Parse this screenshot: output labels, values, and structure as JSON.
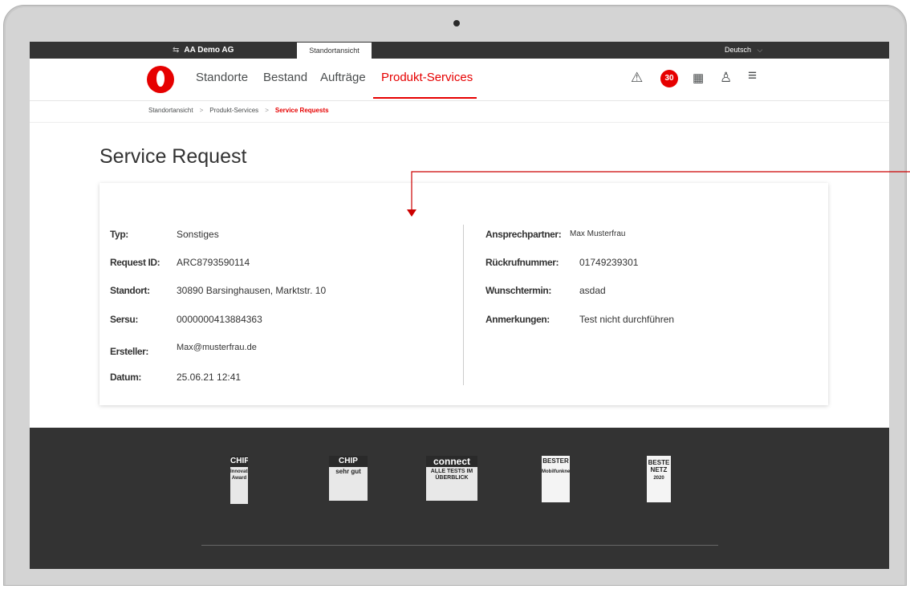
{
  "topbar": {
    "company": "AA Demo AG",
    "view_tab": "Standortansicht",
    "language": "Deutsch"
  },
  "nav": {
    "items": [
      "Standorte",
      "Bestand",
      "Aufträge",
      "Produkt-Services"
    ],
    "active_index": 3,
    "notification_count": "30",
    "icons": [
      "alert-triangle-icon",
      "calendar-icon",
      "user-icon",
      "menu-icon"
    ]
  },
  "breadcrumb": {
    "items": [
      "Standortansicht",
      "Produkt-Services",
      "Service Requests"
    ]
  },
  "page": {
    "title": "Service Request"
  },
  "details": {
    "left": [
      {
        "label": "Typ:",
        "value": "Sonstiges"
      },
      {
        "label": "Request ID:",
        "value": "ARC8793590114"
      },
      {
        "label": "Standort:",
        "value": "30890 Barsinghausen, Marktstr. 10"
      },
      {
        "label": "Sersu:",
        "value": "0000000413884363"
      },
      {
        "label": "Ersteller:",
        "value": "Max@musterfrau.de"
      },
      {
        "label": "Datum:",
        "value": "25.06.21 12:41"
      }
    ],
    "right": [
      {
        "label": "Ansprechpartner:",
        "value": "Max Musterfrau"
      },
      {
        "label": "Rückrufnummer:",
        "value": "01749239301"
      },
      {
        "label": "Wunschtermin:",
        "value": "asdad"
      },
      {
        "label": "Anmerkungen:",
        "value": "Test nicht durchführen"
      }
    ]
  },
  "footer": {
    "awards": [
      {
        "name": "CHIP",
        "sub": "Innovations Award"
      },
      {
        "name": "CHIP",
        "sub": "sehr gut"
      },
      {
        "name": "connect",
        "sub": "ALLE TESTS IM ÜBERBLICK"
      },
      {
        "name": "BESTER",
        "sub": "Mobilfunknetz"
      },
      {
        "name": "BESTE NETZ",
        "sub": "2020"
      }
    ]
  },
  "colors": {
    "accent": "#e60000",
    "dark": "#333333",
    "text": "#4a4d4e"
  }
}
